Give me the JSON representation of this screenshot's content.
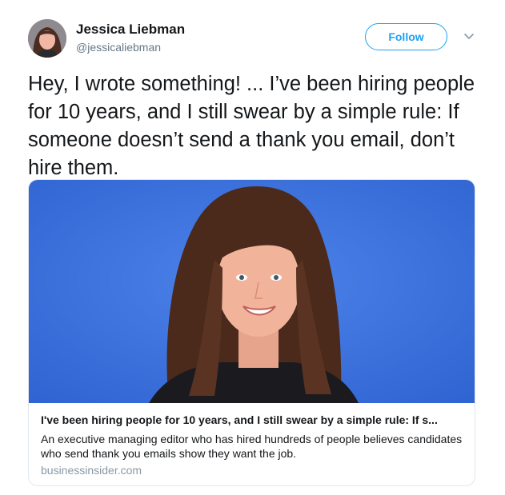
{
  "author": {
    "name": "Jessica Liebman",
    "handle": "@jessicaliebman",
    "avatar_icon": "profile-photo"
  },
  "actions": {
    "follow_label": "Follow",
    "more_icon": "chevron-down-icon"
  },
  "tweet": {
    "text": "Hey, I wrote something! ... I’ve been hiring people for 10 years, and I still swear by a simple rule: If someone doesn’t send a thank you email, don’t hire them."
  },
  "card": {
    "title": "I've been hiring people for 10 years, and I still swear by a simple rule: If s...",
    "description": "An executive managing editor who has hired hundreds of people believes candidates who send thank you emails show they want the job.",
    "domain": "businessinsider.com",
    "image_subject": "portrait-photo"
  },
  "colors": {
    "brand_blue": "#1da1f2",
    "secondary_text": "#657786",
    "domain_text": "#8899a6",
    "card_border": "#e1e8ed",
    "photo_background": "#3f74e0"
  }
}
